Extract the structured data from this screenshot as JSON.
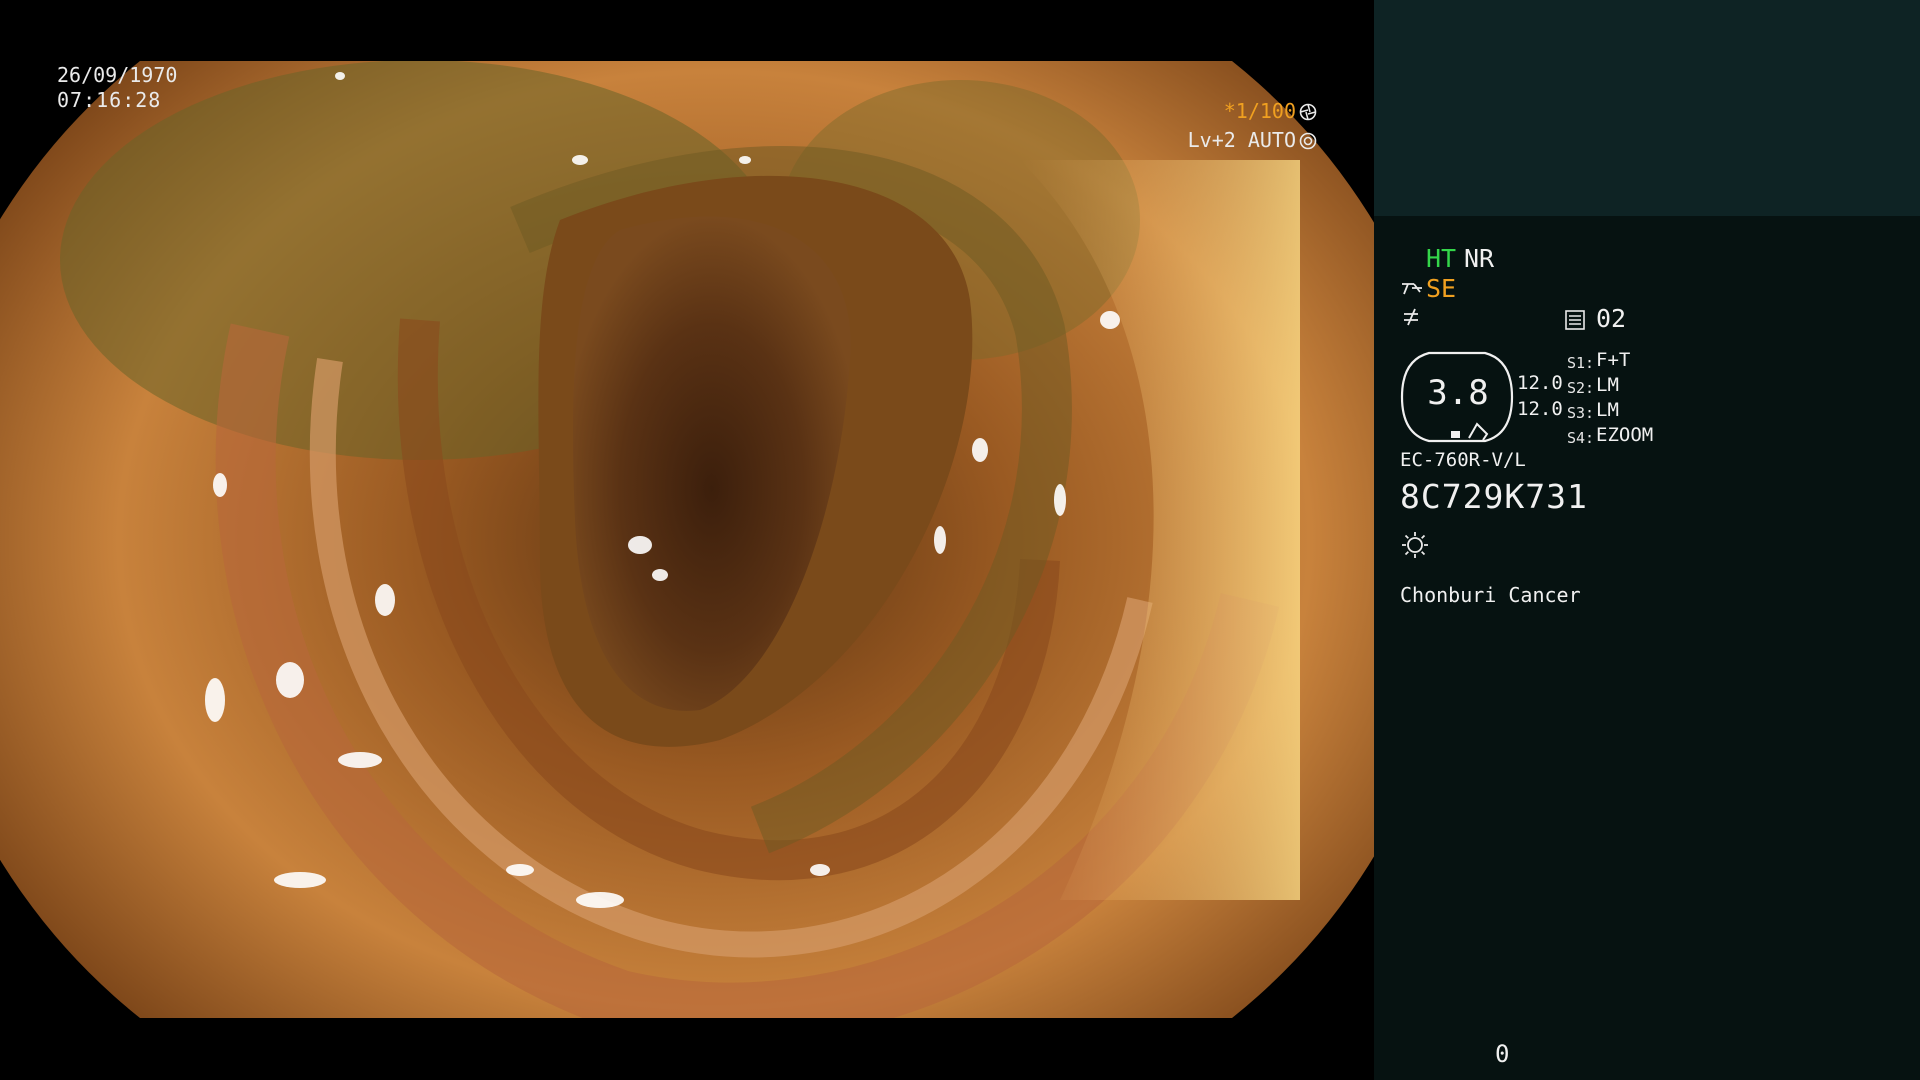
{
  "view": {
    "date": "26/09/1970",
    "time": "07:16:28",
    "shutter_speed": "*1/100",
    "light_mode": "Lv+2 AUTO"
  },
  "panel": {
    "mode_ht": "HT",
    "mode_nr": "NR",
    "mode_se": "SE",
    "memory_value": "02",
    "gauge_value": "3.8",
    "value_1": "12.0",
    "value_2": "12.0",
    "switches": [
      {
        "key": "S1:",
        "value": "F+T"
      },
      {
        "key": "S2:",
        "value": "LM"
      },
      {
        "key": "S3:",
        "value": "LM"
      },
      {
        "key": "S4:",
        "value": "EZOOM"
      }
    ],
    "scope_model": "EC-760R-V/L",
    "scope_serial": "8C729K731",
    "hospital": "Chonburi Cancer",
    "counter": "0"
  },
  "colors": {
    "panel_bg": "#061211",
    "panel_top_bg": "#0e2324",
    "ht_green": "#34d64a",
    "se_orange": "#f0a020"
  },
  "icons": [
    "shutter-icon",
    "iris-icon",
    "scope-se-icon",
    "enhance-icon",
    "memory-icon",
    "light-icon"
  ]
}
